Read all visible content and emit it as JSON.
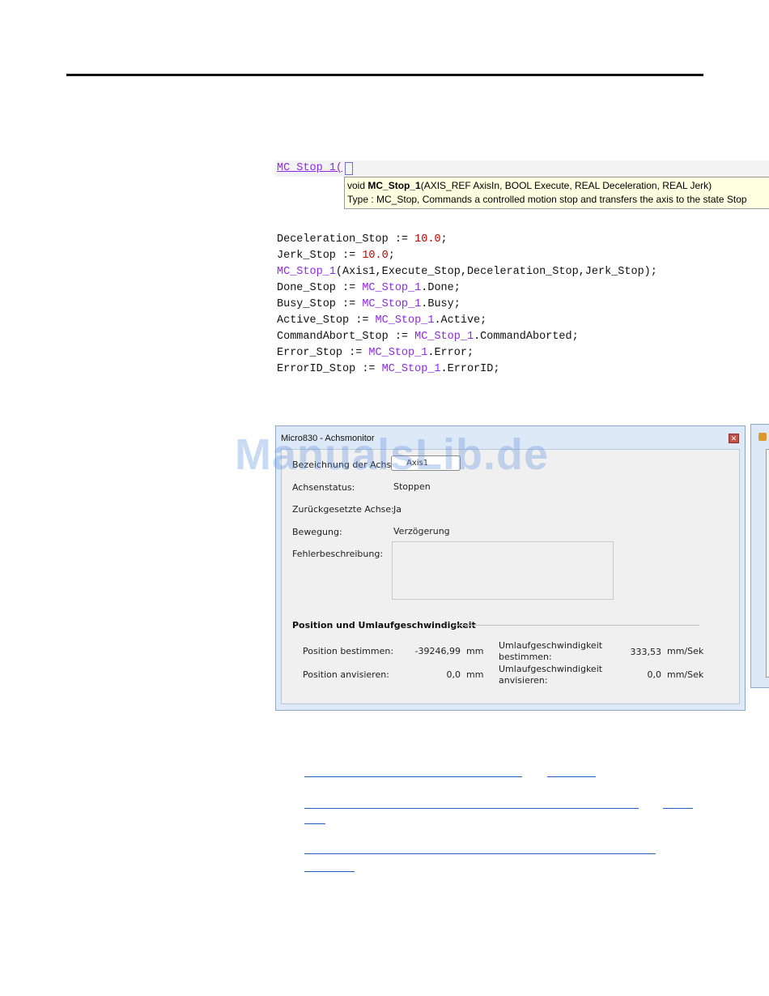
{
  "code_editor": {
    "input_line": "MC_Stop_1(",
    "tooltip": {
      "line1_prefix": "void ",
      "line1_name": "MC_Stop_1",
      "line1_args": "(AXIS_REF AxisIn, BOOL Execute, REAL Deceleration, REAL Jerk)",
      "line2": "Type : MC_Stop, Commands a controlled motion stop and transfers the axis to the state Stop"
    }
  },
  "code_lines": [
    {
      "p1": "Deceleration_Stop := ",
      "n": "10.0",
      "p3": ";"
    },
    {
      "p1": "Jerk_Stop := ",
      "n": "10.0",
      "p3": ";"
    },
    {
      "fb": "MC_Stop_1",
      "p2": "(Axis1,Execute_Stop,Deceleration_Stop,Jerk_Stop);"
    },
    {
      "p1": "Done_Stop := ",
      "fb": "MC_Stop_1",
      "p2": ".Done;"
    },
    {
      "p1": "Busy_Stop := ",
      "fb": "MC_Stop_1",
      "p2": ".Busy;"
    },
    {
      "p1": "Active_Stop := ",
      "fb": "MC_Stop_1",
      "p2": ".Active;"
    },
    {
      "p1": "CommandAbort_Stop := ",
      "fb": "MC_Stop_1",
      "p2": ".CommandAborted;"
    },
    {
      "p1": "Error_Stop := ",
      "fb": "MC_Stop_1",
      "p2": ".Error;"
    },
    {
      "p1": "ErrorID_Stop := ",
      "fb": "MC_Stop_1",
      "p2": ".ErrorID;"
    }
  ],
  "window": {
    "title": "Micro830 - Achsmonitor",
    "close_icon": "close-icon",
    "axis_name_label": "Bezeichnung der Achse:",
    "axis_name_value": "Axis1",
    "axis_status_label": "Achsenstatus:",
    "axis_status_value": "Stoppen",
    "reset_axis_label": "Zurückgesetzte Achse:",
    "reset_axis_value": "Ja",
    "motion_label": "Bewegung:",
    "motion_value": "Verzögerung",
    "error_desc_label": "Fehlerbeschreibung:",
    "section_title": "Position und Umlaufgeschwindigkeit",
    "pos_actual_label": "Position bestimmen:",
    "pos_actual_value": "-39246,99",
    "pos_actual_unit": "mm",
    "pos_target_label": "Position anvisieren:",
    "pos_target_value": "0,0",
    "pos_target_unit": "mm",
    "vel_actual_label_1": "Umlaufgeschwindigkeit",
    "vel_actual_label_2": "bestimmen:",
    "vel_actual_value": "333,53",
    "vel_actual_unit": "mm/Sek",
    "vel_target_label_1": "Umlaufgeschwindigkeit",
    "vel_target_label_2": "anvisieren:",
    "vel_target_value": "0,0",
    "vel_target_unit": "mm/Sek"
  },
  "watermark": "ManualsLib.de"
}
